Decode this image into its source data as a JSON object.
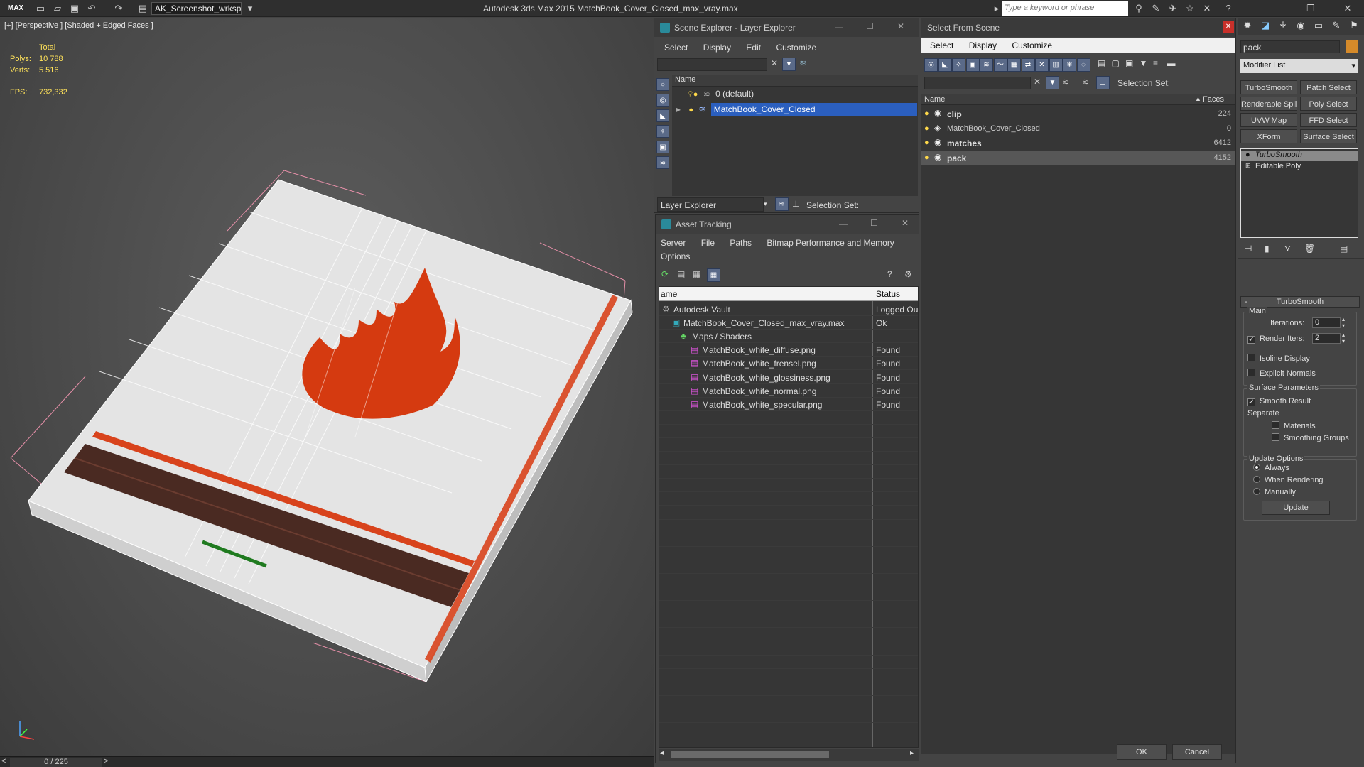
{
  "app": {
    "workspace": "AK_Screenshot_wrksp",
    "title": "Autodesk 3ds Max 2015    MatchBook_Cover_Closed_max_vray.max",
    "search_placeholder": "Type a keyword or phrase",
    "logo": "MAX"
  },
  "viewport": {
    "label": "[+] [Perspective ] [Shaded + Edged Faces ]",
    "stats": {
      "total_label": "Total",
      "polys_label": "Polys:",
      "polys": "10 788",
      "verts_label": "Verts:",
      "verts": "5 516",
      "fps_label": "FPS:",
      "fps": "732,332"
    },
    "timeline": "0 / 225"
  },
  "scene_explorer": {
    "title": "Scene Explorer - Layer Explorer",
    "menu": [
      "Select",
      "Display",
      "Edit",
      "Customize"
    ],
    "col_name": "Name",
    "layers": [
      "0 (default)",
      "MatchBook_Cover_Closed"
    ],
    "footer_dropdown": "Layer Explorer",
    "selection_set_label": "Selection Set:"
  },
  "asset_tracking": {
    "title": "Asset Tracking",
    "menu": [
      "Server",
      "File",
      "Paths",
      "Bitmap Performance and Memory"
    ],
    "menu2": "Options",
    "col_name": "ame",
    "col_status": "Status",
    "rows": [
      {
        "name": "Autodesk Vault",
        "status": "Logged Ou"
      },
      {
        "name": "MatchBook_Cover_Closed_max_vray.max",
        "status": "Ok"
      },
      {
        "name": "Maps / Shaders",
        "status": ""
      },
      {
        "name": "MatchBook_white_diffuse.png",
        "status": "Found"
      },
      {
        "name": "MatchBook_white_frensel.png",
        "status": "Found"
      },
      {
        "name": "MatchBook_white_glossiness.png",
        "status": "Found"
      },
      {
        "name": "MatchBook_white_normal.png",
        "status": "Found"
      },
      {
        "name": "MatchBook_white_specular.png",
        "status": "Found"
      }
    ]
  },
  "select_from_scene": {
    "title": "Select From Scene",
    "menu": [
      "Select",
      "Display",
      "Customize"
    ],
    "selection_set_label": "Selection Set:",
    "col_name": "Name",
    "col_faces": "Faces",
    "rows": [
      {
        "name": "clip",
        "faces": "224"
      },
      {
        "name": "MatchBook_Cover_Closed",
        "faces": "0"
      },
      {
        "name": "matches",
        "faces": "6412"
      },
      {
        "name": "pack",
        "faces": "4152"
      }
    ],
    "ok": "OK",
    "cancel": "Cancel"
  },
  "command_panel": {
    "object_name": "pack",
    "modifier_list": "Modifier List",
    "buttons": [
      "TurboSmooth",
      "Patch Select",
      "Renderable Spline",
      "Poly Select",
      "UVW Map",
      "FFD Select",
      "XForm",
      "Surface Select"
    ],
    "stack": [
      "TurboSmooth",
      "Editable Poly"
    ],
    "rollout_title": "TurboSmooth",
    "main_label": "Main",
    "iterations_label": "Iterations:",
    "iterations": "0",
    "render_iters_label": "Render Iters:",
    "render_iters": "2",
    "isoline": "Isoline Display",
    "explicit_normals": "Explicit Normals",
    "surface_params": "Surface Parameters",
    "smooth_result": "Smooth Result",
    "separate_label": "Separate",
    "materials": "Materials",
    "smoothing_groups": "Smoothing Groups",
    "update_options": "Update Options",
    "always": "Always",
    "when_rendering": "When Rendering",
    "manually": "Manually",
    "update": "Update"
  },
  "colors": {
    "selection": "#2b5fbf",
    "stat_yellow": "#ffe25a",
    "flame": "#d53a10"
  }
}
